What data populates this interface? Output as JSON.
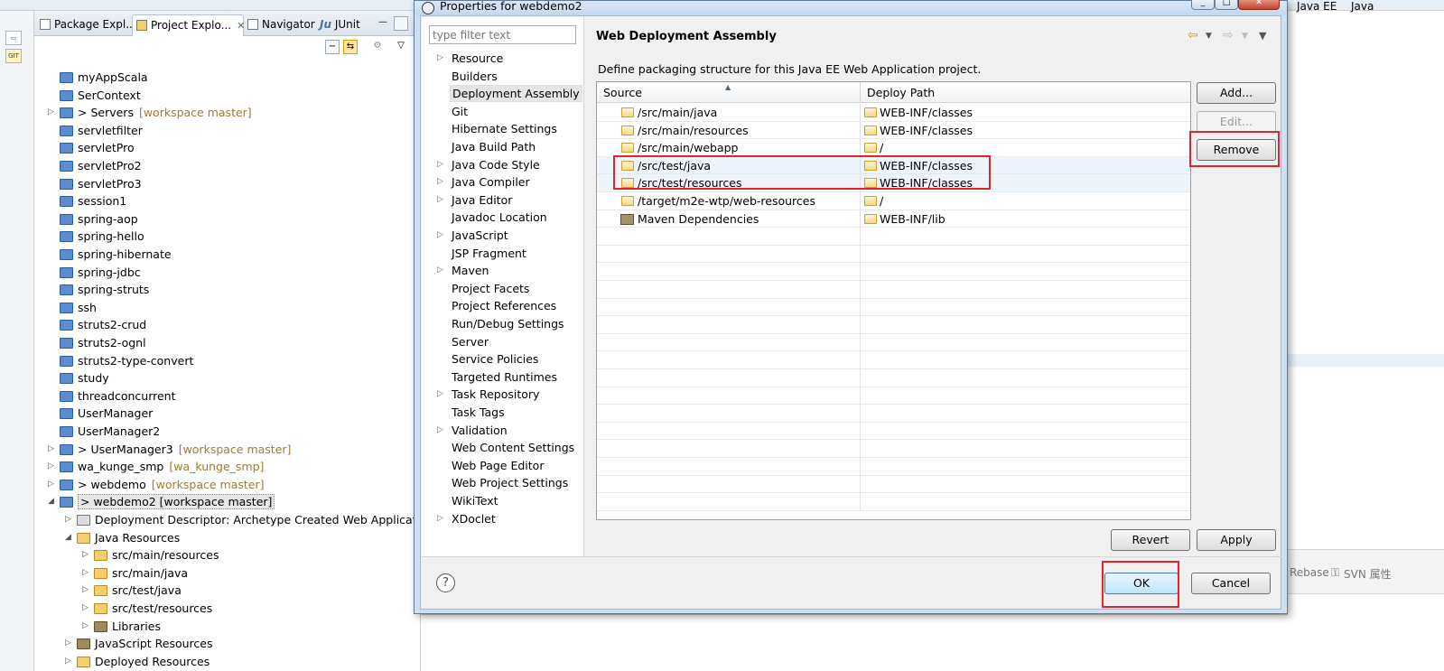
{
  "eclipse": {
    "tabs": [
      {
        "label": "Package Expl..."
      },
      {
        "label": "Project Explo...",
        "close": "✕"
      },
      {
        "label": "Navigator"
      },
      {
        "label": "JUnit",
        "prefix": "Ju"
      }
    ],
    "tree": [
      {
        "label": "myAppScala",
        "icon": "project-icon"
      },
      {
        "label": "SerContext",
        "icon": "project-icon"
      },
      {
        "label": "> Servers",
        "decoration": "[workspace master]",
        "icon": "git-project-icon",
        "twisty": "▷"
      },
      {
        "label": "servletfilter",
        "icon": "project-icon"
      },
      {
        "label": "servletPro",
        "icon": "project-icon"
      },
      {
        "label": "servletPro2",
        "icon": "project-icon"
      },
      {
        "label": "servletPro3",
        "icon": "project-icon"
      },
      {
        "label": "session1",
        "icon": "project-icon"
      },
      {
        "label": "spring-aop",
        "icon": "project-icon"
      },
      {
        "label": "spring-hello",
        "icon": "project-icon"
      },
      {
        "label": "spring-hibernate",
        "icon": "project-icon"
      },
      {
        "label": "spring-jdbc",
        "icon": "project-icon"
      },
      {
        "label": "spring-struts",
        "icon": "project-icon"
      },
      {
        "label": "ssh",
        "icon": "project-icon"
      },
      {
        "label": "struts2-crud",
        "icon": "project-icon"
      },
      {
        "label": "struts2-ognl",
        "icon": "project-icon"
      },
      {
        "label": "struts2-type-convert",
        "icon": "project-icon"
      },
      {
        "label": "study",
        "icon": "project-icon"
      },
      {
        "label": "threadconcurrent",
        "icon": "project-icon"
      },
      {
        "label": "UserManager",
        "icon": "project-icon"
      },
      {
        "label": "UserManager2",
        "icon": "project-icon"
      },
      {
        "label": "> UserManager3",
        "decoration": "[workspace master]",
        "icon": "git-project-icon",
        "twisty": "▷"
      },
      {
        "label": "wa_kunge_smp",
        "decoration": "[wa_kunge_smp]",
        "icon": "git-project-icon",
        "twisty": "▷"
      },
      {
        "label": "> webdemo",
        "decoration": "[workspace master]",
        "icon": "git-project-icon",
        "twisty": "▷"
      },
      {
        "label": "> webdemo2  [workspace master]",
        "icon": "git-project-icon",
        "twisty": "◢",
        "selected": true
      },
      {
        "label": "Deployment Descriptor: Archetype Created Web Application",
        "icon": "descriptor-icon",
        "twisty": "▷",
        "indent": 1
      },
      {
        "label": "Java Resources",
        "icon": "package-icon",
        "twisty": "◢",
        "indent": 1
      },
      {
        "label": "src/main/resources",
        "icon": "package-icon",
        "twisty": "▷",
        "indent": 2
      },
      {
        "label": "src/main/java",
        "icon": "package-icon",
        "twisty": "▷",
        "indent": 2
      },
      {
        "label": "src/test/java",
        "icon": "package-icon",
        "twisty": "▷",
        "indent": 2
      },
      {
        "label": "src/test/resources",
        "icon": "package-icon",
        "twisty": "▷",
        "indent": 2
      },
      {
        "label": "Libraries",
        "icon": "library-icon",
        "twisty": "▷",
        "indent": 2
      },
      {
        "label": "JavaScript Resources",
        "icon": "library-icon",
        "twisty": "▷",
        "indent": 1
      },
      {
        "label": "Deployed Resources",
        "icon": "package-icon",
        "twisty": "▷",
        "indent": 1
      }
    ],
    "right": {
      "perspective_1": "Java EE",
      "perspective_2": "Java",
      "bottom_rebase": "Rebase",
      "bottom_svn": "SVN 属性"
    }
  },
  "dialog": {
    "title": "Properties for webdemo2",
    "filter_placeholder": "type filter text",
    "nav": [
      {
        "label": "Resource",
        "expandable": true
      },
      {
        "label": "Builders"
      },
      {
        "label": "Deployment Assembly",
        "selected": true
      },
      {
        "label": "Git"
      },
      {
        "label": "Hibernate Settings"
      },
      {
        "label": "Java Build Path"
      },
      {
        "label": "Java Code Style",
        "expandable": true
      },
      {
        "label": "Java Compiler",
        "expandable": true
      },
      {
        "label": "Java Editor",
        "expandable": true
      },
      {
        "label": "Javadoc Location"
      },
      {
        "label": "JavaScript",
        "expandable": true
      },
      {
        "label": "JSP Fragment"
      },
      {
        "label": "Maven",
        "expandable": true
      },
      {
        "label": "Project Facets"
      },
      {
        "label": "Project References"
      },
      {
        "label": "Run/Debug Settings"
      },
      {
        "label": "Server"
      },
      {
        "label": "Service Policies"
      },
      {
        "label": "Targeted Runtimes"
      },
      {
        "label": "Task Repository",
        "expandable": true
      },
      {
        "label": "Task Tags"
      },
      {
        "label": "Validation",
        "expandable": true
      },
      {
        "label": "Web Content Settings"
      },
      {
        "label": "Web Page Editor"
      },
      {
        "label": "Web Project Settings"
      },
      {
        "label": "WikiText"
      },
      {
        "label": "XDoclet",
        "expandable": true
      }
    ],
    "page_title": "Web Deployment Assembly",
    "page_description": "Define packaging structure for this Java EE Web Application project.",
    "table": {
      "headers": [
        "Source",
        "Deploy Path"
      ],
      "rows": [
        {
          "source": "/src/main/java",
          "deploy": "WEB-INF/classes",
          "icon": "folder-icon"
        },
        {
          "source": "/src/main/resources",
          "deploy": "WEB-INF/classes",
          "icon": "folder-icon"
        },
        {
          "source": "/src/main/webapp",
          "deploy": "/",
          "icon": "folder-icon"
        },
        {
          "source": "/src/test/java",
          "deploy": "WEB-INF/classes",
          "icon": "folder-icon",
          "highlighted": true
        },
        {
          "source": "/src/test/resources",
          "deploy": "WEB-INF/classes",
          "icon": "folder-icon",
          "highlighted": true
        },
        {
          "source": "/target/m2e-wtp/web-resources",
          "deploy": "/",
          "icon": "folder-icon"
        },
        {
          "source": "Maven Dependencies",
          "deploy": "WEB-INF/lib",
          "icon": "library-icon"
        }
      ]
    },
    "buttons": {
      "add": "Add...",
      "edit": "Edit...",
      "remove": "Remove",
      "revert": "Revert",
      "apply": "Apply",
      "ok": "OK",
      "cancel": "Cancel",
      "help": "?"
    },
    "annotation_color": "#e0262a"
  }
}
